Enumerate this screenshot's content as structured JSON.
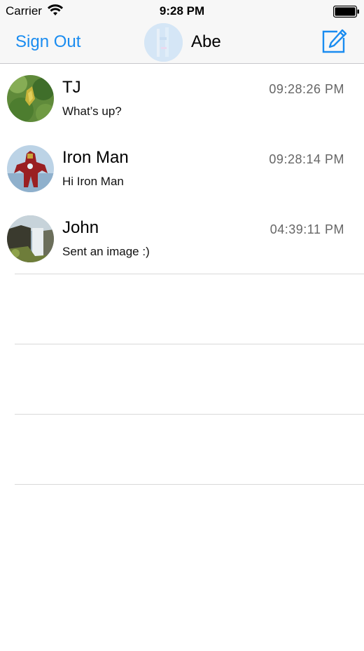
{
  "status_bar": {
    "carrier": "Carrier",
    "time": "9:28 PM",
    "icons": [
      "wifi-icon",
      "battery-icon"
    ]
  },
  "nav_bar": {
    "left_button": "Sign Out",
    "title": "Abe",
    "right_icon": "compose-icon",
    "accent_color": "#1a8cf0"
  },
  "conversations": [
    {
      "name": "TJ",
      "time": "09:28:26 PM",
      "message": "What’s up?"
    },
    {
      "name": "Iron Man",
      "time": "09:28:14 PM",
      "message": "Hi Iron Man"
    },
    {
      "name": "John",
      "time": "04:39:11 PM",
      "message": "Sent an image :)"
    }
  ]
}
